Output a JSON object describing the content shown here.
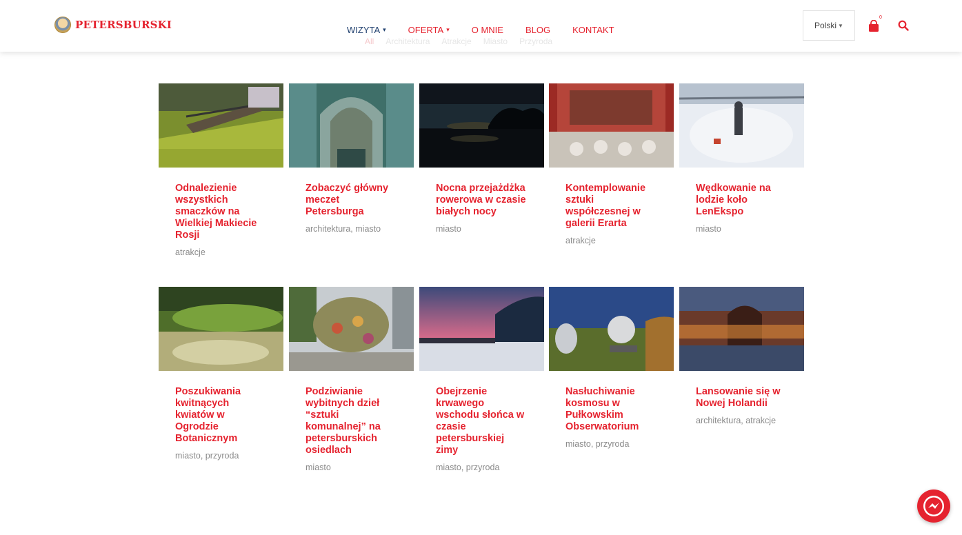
{
  "brand": {
    "name": "PETERSBURSKI"
  },
  "nav": [
    {
      "label": "WIZYTA",
      "dropdown": true,
      "active": true
    },
    {
      "label": "OFERTA",
      "dropdown": true,
      "active": false
    },
    {
      "label": "O MNIE",
      "dropdown": false,
      "active": false
    },
    {
      "label": "BLOG",
      "dropdown": false,
      "active": false
    },
    {
      "label": "KONTAKT",
      "dropdown": false,
      "active": false
    }
  ],
  "filters": [
    "All",
    "Architektura",
    "Atrakcje",
    "Miasto",
    "Przyroda"
  ],
  "language": {
    "selected": "Polski"
  },
  "cart": {
    "count": "0"
  },
  "colors": {
    "accent": "#e5232f",
    "nav_active": "#1f3f6e",
    "tags": "#8a8a8a"
  },
  "cards": [
    {
      "title": "Odnalezienie wszystkich smaczków na Wielkiej Makiecie Rosji",
      "tags": "atrakcje"
    },
    {
      "title": "Zobaczyć główny meczet Petersburga",
      "tags": "architektura, miasto"
    },
    {
      "title": "Nocna przejażdżka rowerowa w czasie białych nocy",
      "tags": "miasto"
    },
    {
      "title": "Kontemplowanie sztuki współczesnej w galerii Erarta",
      "tags": "atrakcje"
    },
    {
      "title": "Wędkowanie na lodzie koło LenEkspo",
      "tags": "miasto"
    },
    {
      "title": "Poszukiwania kwitnących kwiatów w Ogrodzie Botanicznym",
      "tags": "miasto, przyroda"
    },
    {
      "title": "Podziwianie wybitnych dzieł “sztuki komunalnej” na petersburskich osiedlach",
      "tags": "miasto"
    },
    {
      "title": "Obejrzenie krwawego wschodu słońca w czasie petersburskiej zimy",
      "tags": "miasto, przyroda"
    },
    {
      "title": "Nasłuchiwanie kosmosu w Pułkowskim Obserwatorium",
      "tags": "miasto, przyroda"
    },
    {
      "title": "Lansowanie się w Nowej Holandii",
      "tags": "architektura, atrakcje"
    }
  ]
}
